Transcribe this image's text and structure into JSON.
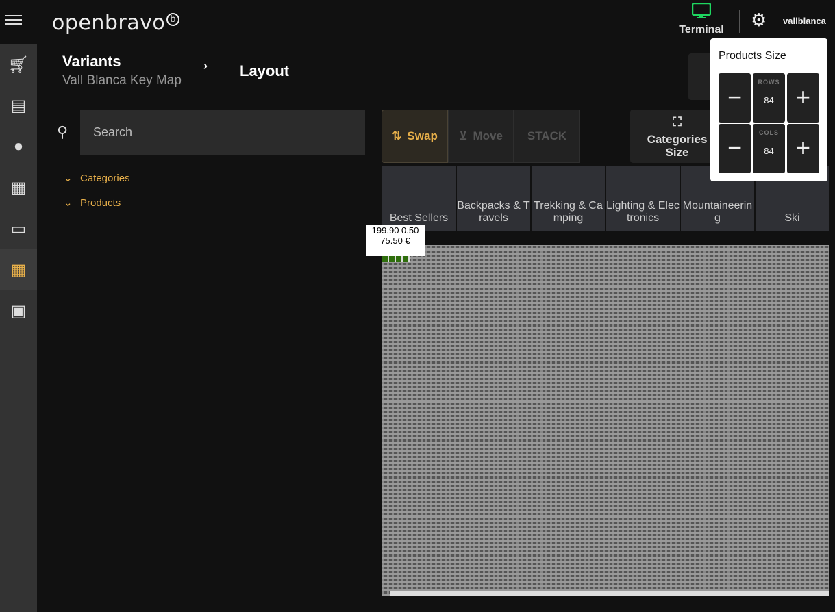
{
  "header": {
    "logo": "openbravo",
    "terminal_label": "Terminal",
    "user": "vallblanca",
    "terminal_color": "#1ed760"
  },
  "sidebar": {
    "items": [
      {
        "icon": "cart-icon"
      },
      {
        "icon": "receipt-icon"
      },
      {
        "icon": "user-icon"
      },
      {
        "icon": "cash-register-icon"
      },
      {
        "icon": "ticket-icon"
      },
      {
        "icon": "grid-edit-icon",
        "active": true
      },
      {
        "icon": "gift-card-icon"
      }
    ]
  },
  "breadcrumb": {
    "title": "Variants",
    "subtitle": "Vall Blanca Key Map",
    "current": "Layout"
  },
  "search": {
    "placeholder": "Search"
  },
  "tree": [
    "Categories",
    "Products"
  ],
  "tools": {
    "swap": "Swap",
    "move": "Move",
    "stack": "STACK",
    "categories_size_1": "Categories",
    "categories_size_2": "Size"
  },
  "tabs": [
    "Best Sellers",
    "Backpacks & Travels",
    "Trekking & Camping",
    "Lighting & Electronics",
    "Mountaineering",
    "Ski"
  ],
  "product_preview": {
    "line1": "199.90 0.50",
    "line2": "75.50 €"
  },
  "popover": {
    "title": "Products Size",
    "rows_label": "ROWS",
    "rows": "84",
    "cols_label": "COLS",
    "cols": "84"
  },
  "accent": "#e8b04a"
}
